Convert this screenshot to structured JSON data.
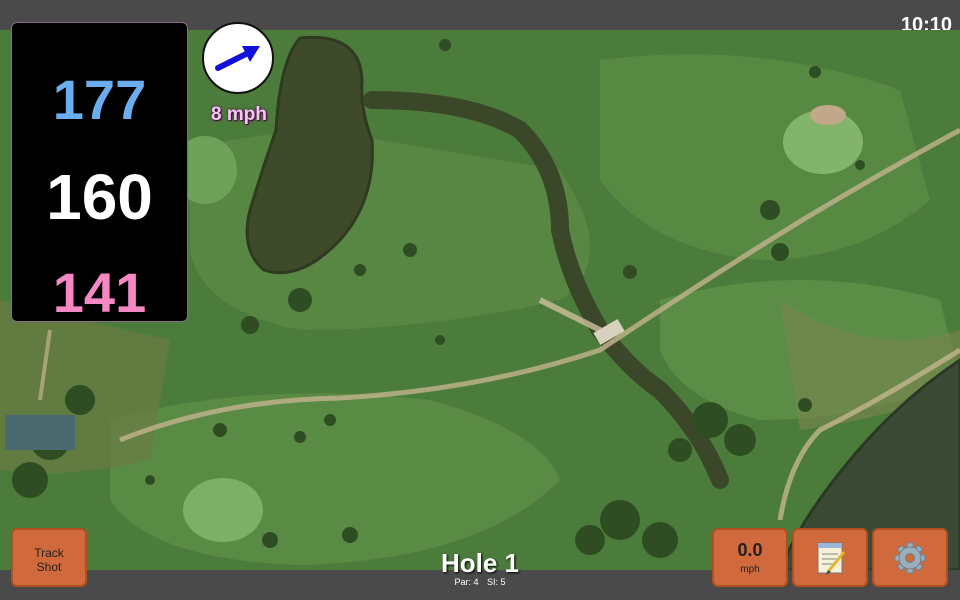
{
  "status_bar": {
    "time": "10:10"
  },
  "distances": {
    "back": "177",
    "middle": "160",
    "front": "141",
    "colors": {
      "back": "#6aaef0",
      "middle": "#ffffff",
      "front": "#f587c5"
    }
  },
  "wind": {
    "speed_label": "8 mph",
    "direction_icon": "arrow-right-icon",
    "arrow_color": "#1010d8"
  },
  "hole": {
    "title": "Hole 1",
    "par_label": "Par: 4",
    "si_label": "SI: 5"
  },
  "buttons": {
    "track_shot": {
      "line1": "Track",
      "line2": "Shot"
    },
    "speed": {
      "value": "0.0",
      "unit": "mph"
    },
    "notes": {
      "icon": "notepad-icon"
    },
    "settings": {
      "icon": "gear-icon"
    }
  },
  "colors": {
    "button_bg": "#d0693b",
    "button_border": "#b0501e",
    "panel_bg": "#000000"
  }
}
